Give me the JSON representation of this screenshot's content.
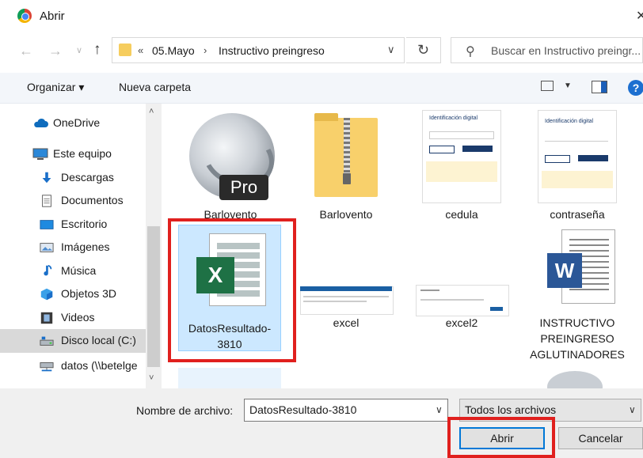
{
  "window": {
    "title": "Abrir",
    "close": "✕"
  },
  "nav": {
    "back": "←",
    "forward": "→",
    "recent": "∨",
    "up": "↑",
    "refresh": "↻"
  },
  "address": {
    "chevrons": "«",
    "crumbs": [
      "05.Mayo",
      "Instructivo preingreso"
    ],
    "separator": "›",
    "dropdown": "∨"
  },
  "search": {
    "placeholder": "Buscar en Instructivo preingr...",
    "icon": "search-icon"
  },
  "toolbar": {
    "organize": "Organizar ▾",
    "new_folder": "Nueva carpeta",
    "view_drop": "▼",
    "help": "?"
  },
  "sidebar": {
    "items": [
      {
        "label": "OneDrive",
        "icon": "cloud-icon"
      },
      {
        "label": "Este equipo",
        "icon": "computer-icon"
      },
      {
        "label": "Descargas",
        "icon": "download-icon"
      },
      {
        "label": "Documentos",
        "icon": "document-icon"
      },
      {
        "label": "Escritorio",
        "icon": "desktop-icon"
      },
      {
        "label": "Imágenes",
        "icon": "pictures-icon"
      },
      {
        "label": "Música",
        "icon": "music-icon"
      },
      {
        "label": "Objetos 3D",
        "icon": "cube-icon"
      },
      {
        "label": "Videos",
        "icon": "film-icon"
      },
      {
        "label": "Disco local (C:)",
        "icon": "drive-icon"
      },
      {
        "label": "datos (\\\\betelge",
        "icon": "network-drive-icon"
      }
    ],
    "selected": "Disco local (C:)",
    "scroll_up": "˄",
    "scroll_down": "˅"
  },
  "files": [
    {
      "name": "Barlovento",
      "type": "google-earth-pro",
      "badge": "Pro"
    },
    {
      "name": "Barlovento",
      "type": "zip-folder"
    },
    {
      "name": "cedula",
      "type": "screenshot",
      "heading": "Identificación digital"
    },
    {
      "name": "contraseña",
      "type": "screenshot",
      "heading": "Identificación digital"
    },
    {
      "name": "DatosResultado-3810",
      "type": "excel",
      "selected": true,
      "letter": "X"
    },
    {
      "name": "excel",
      "type": "screenshot"
    },
    {
      "name": "excel2",
      "type": "screenshot"
    },
    {
      "name": "INSTRUCTIVO PREINGRESO AGLUTINADORES",
      "type": "word",
      "letter": "W"
    }
  ],
  "footer": {
    "filename_label": "Nombre de archivo:",
    "filename_value": "DatosResultado-3810",
    "filetype": "Todos los archivos",
    "open": "Abrir",
    "cancel": "Cancelar",
    "dropdown": "∨"
  },
  "colors": {
    "highlight_box": "#e0201e",
    "selection": "#cce8ff",
    "excel_green": "#1e7145",
    "word_blue": "#2b5797",
    "accent": "#0078d7"
  }
}
